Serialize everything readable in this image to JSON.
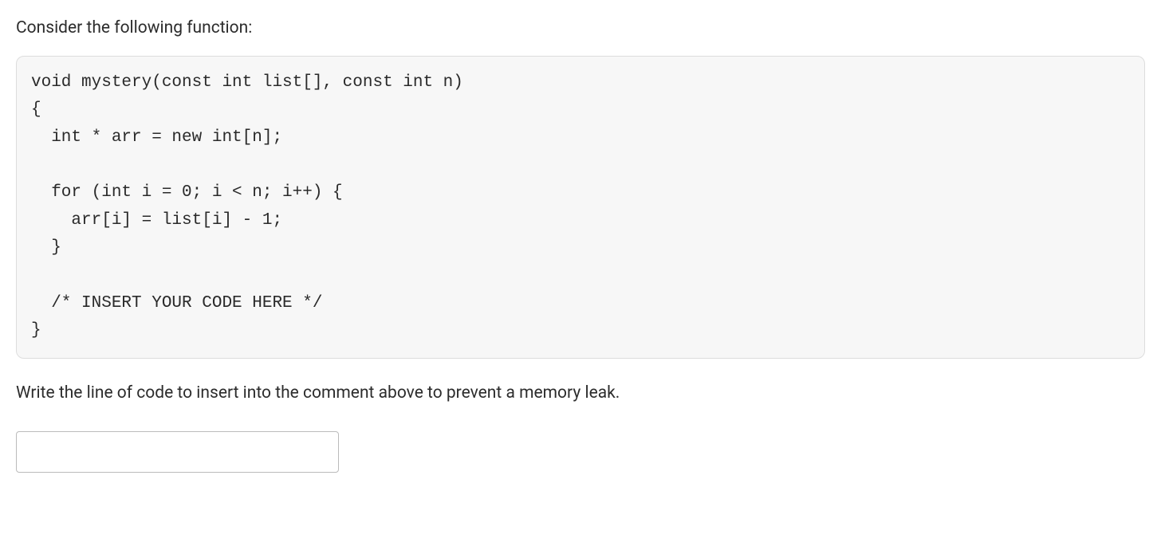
{
  "intro_text": "Consider the following function:",
  "code_lines": [
    "void mystery(const int list[], const int n)",
    "{",
    "  int * arr = new int[n];",
    "",
    "  for (int i = 0; i < n; i++) {",
    "    arr[i] = list[i] - 1;",
    "  }",
    "",
    "  /* INSERT YOUR CODE HERE */",
    "}"
  ],
  "prompt_text": "Write the line of code to insert into the comment above to prevent a memory leak.",
  "answer_value": ""
}
